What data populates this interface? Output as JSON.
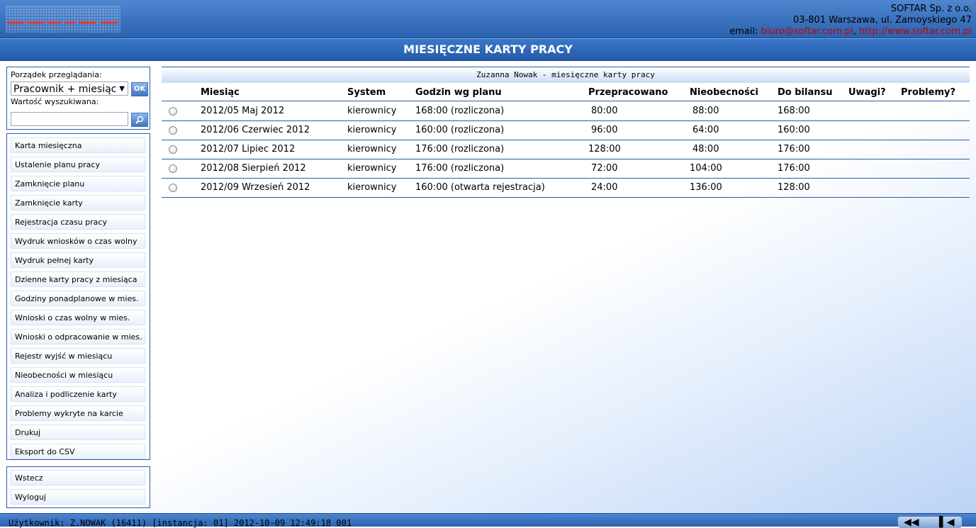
{
  "header": {
    "logo_text": "SOFTAR",
    "company_name": "SOFTAR Sp. z o.o.",
    "address": "03-801 Warszawa, ul. Zamoyskiego 47",
    "email_label": "email: ",
    "email": "biuro@softar.com.pl",
    "separator": ", ",
    "website": "http://www.softar.com.pl"
  },
  "title": "MIESIĘCZNE KARTY PRACY",
  "search": {
    "order_label": "Porządek przeglądania:",
    "order_value": "Pracownik + miesiąc",
    "ok_label": "OK",
    "value_label": "Wartość wyszukiwana:",
    "value": ""
  },
  "menu": [
    "Karta miesięczna",
    "Ustalenie planu pracy",
    "Zamknięcie planu",
    "Zamknięcie karty",
    "Rejestracja czasu pracy",
    "Wydruk wniosków o czas wolny",
    "Wydruk pełnej karty",
    "Dzienne karty pracy z miesiąca",
    "Godziny ponadplanowe w mies.",
    "Wnioski o czas wolny w mies.",
    "Wnioski o odpracowanie w mies.",
    "Rejestr wyjść w miesiącu",
    "Nieobecności w miesiącu",
    "Analiza i podliczenie karty",
    "Problemy wykryte na karcie",
    "Drukuj",
    "Eksport do CSV"
  ],
  "nav": [
    "Wstecz",
    "Wyloguj"
  ],
  "table": {
    "title": "Zuzanna Nowak - miesięczne karty pracy",
    "headers": [
      "Miesiąc",
      "System",
      "Godzin wg planu",
      "Przepracowano",
      "Nieobecności",
      "Do bilansu",
      "Uwagi?",
      "Problemy?"
    ],
    "rows": [
      [
        "2012/05 Maj 2012",
        "kierownicy",
        "168:00 (rozliczona)",
        "80:00",
        "88:00",
        "168:00",
        "",
        ""
      ],
      [
        "2012/06 Czerwiec 2012",
        "kierownicy",
        "160:00 (rozliczona)",
        "96:00",
        "64:00",
        "160:00",
        "",
        ""
      ],
      [
        "2012/07 Lipiec 2012",
        "kierownicy",
        "176:00 (rozliczona)",
        "128:00",
        "48:00",
        "176:00",
        "",
        ""
      ],
      [
        "2012/08 Sierpień 2012",
        "kierownicy",
        "176:00 (rozliczona)",
        "72:00",
        "104:00",
        "176:00",
        "",
        ""
      ],
      [
        "2012/09 Wrzesień 2012",
        "kierownicy",
        "160:00 (otwarta rejestracja)",
        "24:00",
        "136:00",
        "128:00",
        "",
        ""
      ]
    ]
  },
  "status": "Użytkownik: Z.NOWAK (16411) [instancja: 01] 2012-10-09  12:49:18  001"
}
